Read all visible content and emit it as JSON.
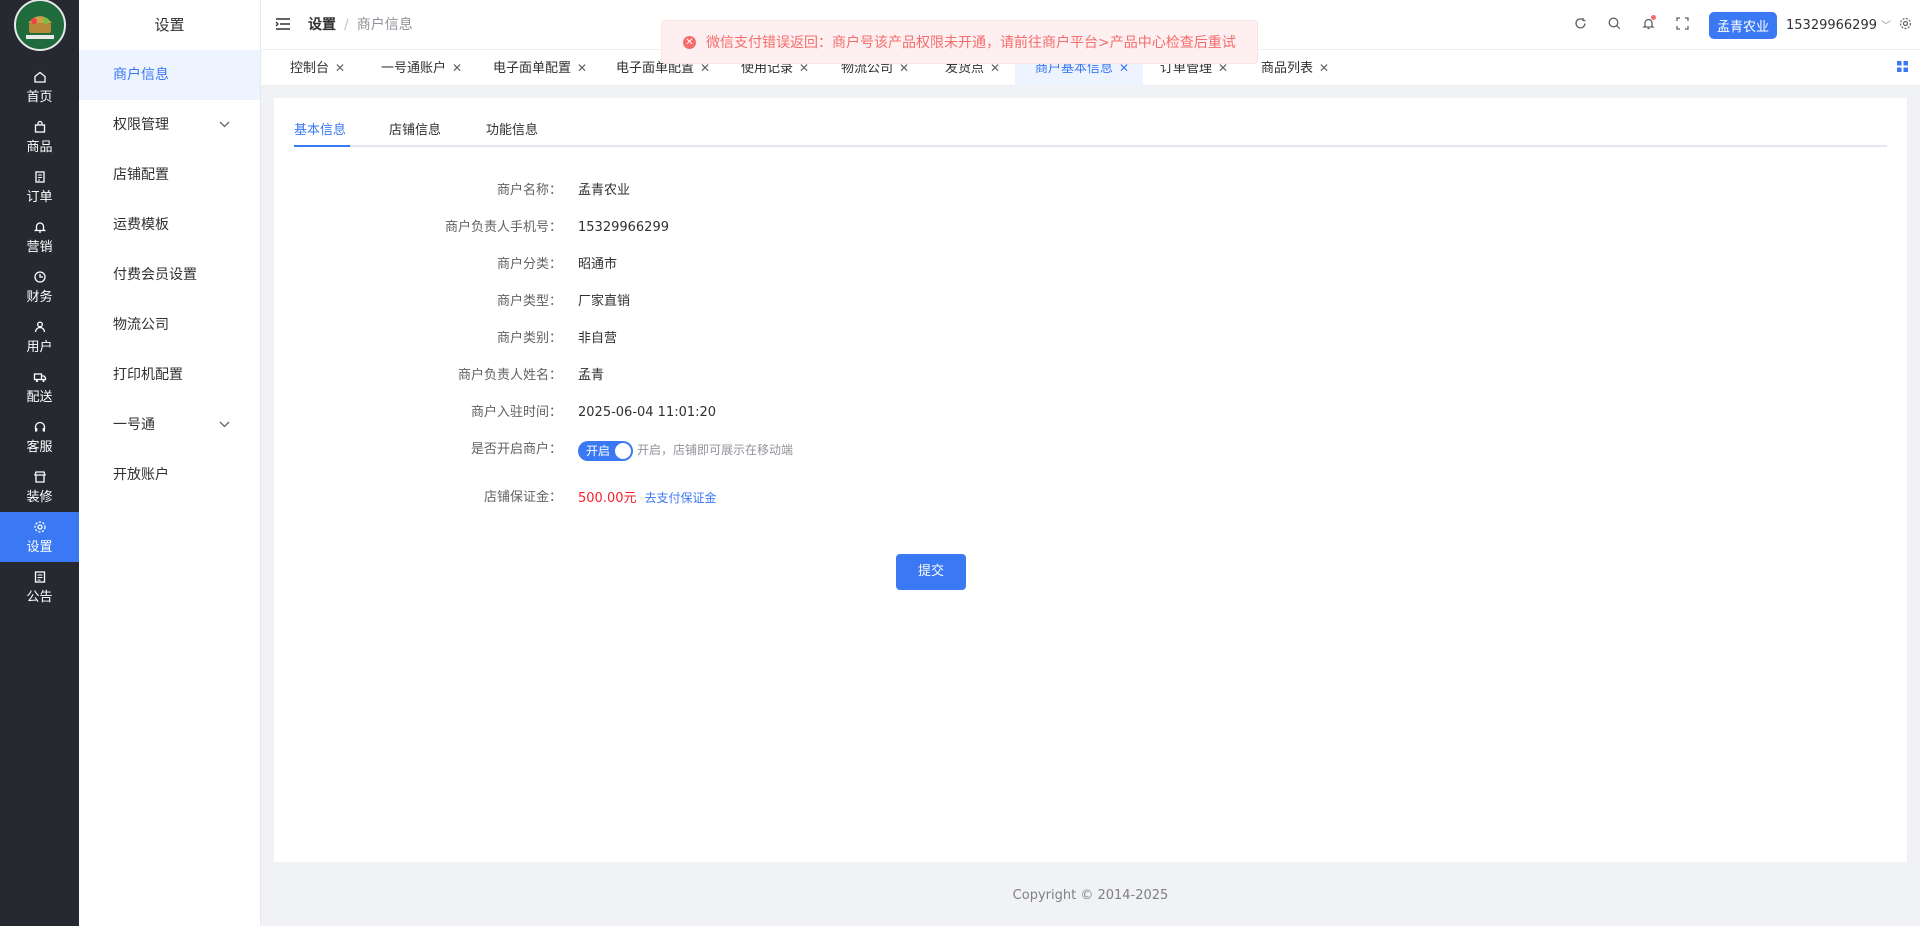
{
  "rail": {
    "items": [
      {
        "label": "首页",
        "icon": "home-icon"
      },
      {
        "label": "商品",
        "icon": "bag-icon"
      },
      {
        "label": "订单",
        "icon": "document-icon"
      },
      {
        "label": "营销",
        "icon": "bell-icon"
      },
      {
        "label": "财务",
        "icon": "clock-icon"
      },
      {
        "label": "用户",
        "icon": "user-icon"
      },
      {
        "label": "配送",
        "icon": "truck-icon"
      },
      {
        "label": "客服",
        "icon": "headset-icon"
      },
      {
        "label": "装修",
        "icon": "shop-icon"
      },
      {
        "label": "设置",
        "icon": "gear-icon"
      },
      {
        "label": "公告",
        "icon": "notice-icon"
      }
    ],
    "active_index": 9
  },
  "sidebar": {
    "title": "设置",
    "items": [
      {
        "label": "商户信息"
      },
      {
        "label": "权限管理"
      },
      {
        "label": "店铺配置"
      },
      {
        "label": "运费模板"
      },
      {
        "label": "付费会员设置"
      },
      {
        "label": "物流公司"
      },
      {
        "label": "打印机配置"
      },
      {
        "label": "一号通"
      },
      {
        "label": "开放账户"
      }
    ]
  },
  "header": {
    "breadcrumb_1": "设置",
    "breadcrumb_sep": "/",
    "breadcrumb_2": "商户信息",
    "shop_name": "孟青农业",
    "user_phone": "15329966299"
  },
  "tabs": [
    {
      "label": "控制台"
    },
    {
      "label": "一号通账户"
    },
    {
      "label": "电子面单配置"
    },
    {
      "label": "电子面单配置"
    },
    {
      "label": "使用记录"
    },
    {
      "label": "物流公司"
    },
    {
      "label": "发货点"
    },
    {
      "label": "商户基本信息"
    },
    {
      "label": "订单管理"
    },
    {
      "label": "商品列表"
    }
  ],
  "subtabs": [
    "基本信息",
    "店铺信息",
    "功能信息"
  ],
  "form": {
    "name_label": "商户名称：",
    "name_value": "孟青农业",
    "phone_label": "商户负责人手机号：",
    "phone_value": "15329966299",
    "cat_label": "商户分类：",
    "cat_value": "昭通市",
    "type_label": "商户类型：",
    "type_value": "厂家直销",
    "kind_label": "商户类别：",
    "kind_value": "非自营",
    "owner_label": "商户负责人姓名：",
    "owner_value": "孟青",
    "time_label": "商户入驻时间：",
    "time_value": "2025-06-04 11:01:20",
    "open_label": "是否开启商户：",
    "open_switch": "开启",
    "open_hint": "开启，店铺即可展示在移动端",
    "deposit_label": "店铺保证金：",
    "deposit_value": "500.00元",
    "deposit_link": "去支付保证金",
    "submit": "提交"
  },
  "footer": "Copyright © 2014-2025",
  "alert": "微信支付错误返回：商户号该产品权限未开通，请前往商户平台>产品中心检查后重试",
  "colors": {
    "primary": "#3b78f3",
    "rail_bg": "#262a30",
    "error": "#f56c6c",
    "money": "#f5222d"
  }
}
